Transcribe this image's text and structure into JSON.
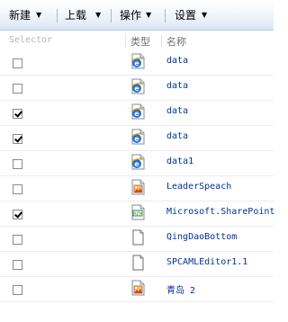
{
  "toolbar": {
    "new_label": "新建",
    "upload_label": "上载",
    "actions_label": "操作",
    "settings_label": "设置"
  },
  "columns": {
    "selector": "Selector",
    "type": "类型",
    "name": "名称"
  },
  "rows": [
    {
      "name": "data",
      "checked": false,
      "icon": "ie-page-icon"
    },
    {
      "name": "data",
      "checked": false,
      "icon": "ie-page-icon"
    },
    {
      "name": "data",
      "checked": true,
      "icon": "ie-page-icon"
    },
    {
      "name": "data",
      "checked": true,
      "icon": "ie-page-icon"
    },
    {
      "name": "data1",
      "checked": false,
      "icon": "ie-page-icon"
    },
    {
      "name": "LeaderSpeach",
      "checked": false,
      "icon": "image-file-icon"
    },
    {
      "name": "Microsoft.SharePoint",
      "checked": true,
      "icon": "xml-file-icon"
    },
    {
      "name": "QingDaoBottom",
      "checked": false,
      "icon": "blank-file-icon"
    },
    {
      "name": "SPCAMLEditor1.1",
      "checked": false,
      "icon": "blank-file-icon"
    },
    {
      "name": "青岛 2",
      "checked": false,
      "icon": "image-file-icon"
    }
  ]
}
